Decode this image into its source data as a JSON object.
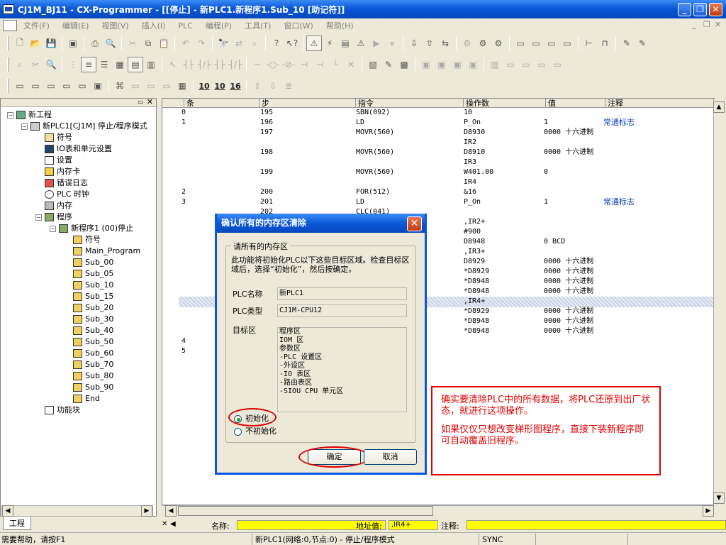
{
  "window": {
    "title": "CJ1M_BJ11 - CX-Programmer - [[停止] - 新PLC1.新程序1.Sub_10 [助记符]]"
  },
  "menu": [
    "文件(F)",
    "编辑(E)",
    "视图(V)",
    "插入(I)",
    "PLC",
    "编程(P)",
    "工具(T)",
    "窗口(W)",
    "帮助(H)"
  ],
  "toolbar": {
    "num1": "10",
    "num2": "10",
    "num3": "16"
  },
  "tree": {
    "root": "新工程",
    "plc": "新PLC1[CJ1M] 停止/程序模式",
    "items": [
      "符号",
      "IO表和单元设置",
      "设置",
      "内存卡",
      "错误日志",
      "PLC 时钟",
      "内存"
    ],
    "programs": "程序",
    "program1": "新程序1 (00)停止",
    "subitems": [
      "符号",
      "Main_Program",
      "Sub_00",
      "Sub_05",
      "Sub_10",
      "Sub_15",
      "Sub_20",
      "Sub_30",
      "Sub_40",
      "Sub_50",
      "Sub_60",
      "Sub_70",
      "Sub_80",
      "Sub_90",
      "End"
    ],
    "function_blocks": "功能块",
    "tab": "工程"
  },
  "grid": {
    "headers": [
      "条",
      "步",
      "指令",
      "操作数",
      "值",
      "注释"
    ],
    "rows": [
      {
        "rung": "0",
        "step": "195",
        "instr": "SBN(092)",
        "op": "10",
        "val": "",
        "comment": ""
      },
      {
        "rung": "1",
        "step": "196",
        "instr": "LD",
        "op": "P_On",
        "val": "1",
        "comment": "常通标志"
      },
      {
        "rung": "",
        "step": "197",
        "instr": "MOVR(560)",
        "op": "D8930",
        "val": "0000 十六进制",
        "comment": ""
      },
      {
        "rung": "",
        "step": "",
        "instr": "",
        "op": "IR2",
        "val": "",
        "comment": ""
      },
      {
        "rung": "",
        "step": "198",
        "instr": "MOVR(560)",
        "op": "D8910",
        "val": "0000 十六进制",
        "comment": ""
      },
      {
        "rung": "",
        "step": "",
        "instr": "",
        "op": "IR3",
        "val": "",
        "comment": ""
      },
      {
        "rung": "",
        "step": "199",
        "instr": "MOVR(560)",
        "op": "W401.00",
        "val": "0",
        "comment": ""
      },
      {
        "rung": "",
        "step": "",
        "instr": "",
        "op": "IR4",
        "val": "",
        "comment": ""
      },
      {
        "rung": "2",
        "step": "200",
        "instr": "FOR(512)",
        "op": "&16",
        "val": "",
        "comment": ""
      },
      {
        "rung": "3",
        "step": "201",
        "instr": "LD",
        "op": "P_On",
        "val": "1",
        "comment": "常通标志"
      },
      {
        "rung": "",
        "step": "202",
        "instr": "CLC(041)",
        "op": "",
        "val": "",
        "comment": ""
      },
      {
        "rung": "",
        "step": "",
        "instr": "",
        "op": ",IR2+",
        "val": "",
        "comment": ""
      },
      {
        "rung": "",
        "step": "",
        "instr": "",
        "op": "#900",
        "val": "",
        "comment": ""
      },
      {
        "rung": "",
        "step": "",
        "instr": "",
        "op": "D8948",
        "val": "0 BCD",
        "comment": ""
      },
      {
        "rung": "",
        "step": "",
        "instr": "",
        "op": ",IR3+",
        "val": "",
        "comment": ""
      },
      {
        "rung": "",
        "step": "",
        "instr": "",
        "op": "D8929",
        "val": "0000 十六进制",
        "comment": ""
      },
      {
        "rung": "",
        "step": "",
        "instr": "",
        "op": "*D8929",
        "val": "0000 十六进制",
        "comment": ""
      },
      {
        "rung": "",
        "step": "",
        "instr": "",
        "op": "*D8948",
        "val": "0000 十六进制",
        "comment": ""
      },
      {
        "rung": "",
        "step": "",
        "instr": "",
        "op": "*D8948",
        "val": "0000 十六进制",
        "comment": ""
      },
      {
        "rung": "",
        "step": "",
        "instr": "",
        "op": ",IR4+",
        "val": "",
        "comment": ""
      },
      {
        "rung": "",
        "step": "",
        "instr": "",
        "op": "*D8929",
        "val": "0000 十六进制",
        "comment": ""
      },
      {
        "rung": "",
        "step": "",
        "instr": "",
        "op": "*D8948",
        "val": "0000 十六进制",
        "comment": ""
      },
      {
        "rung": "",
        "step": "",
        "instr": "",
        "op": "*D8948",
        "val": "0000 十六进制",
        "comment": ""
      },
      {
        "rung": "4",
        "step": "",
        "instr": "",
        "op": "",
        "val": "",
        "comment": ""
      },
      {
        "rung": "5",
        "step": "",
        "instr": "",
        "op": "",
        "val": "",
        "comment": ""
      }
    ]
  },
  "bottom": {
    "name_label": "名称:",
    "addr_label": "地址值:",
    "addr_value": ",IR4+",
    "comment_label": "注释:"
  },
  "status": {
    "help": "需要帮助，请按F1",
    "plc": "新PLC1(网络:0,节点:0) - 停止/程序模式",
    "sync": "SYNC"
  },
  "dialog": {
    "title": "确认所有的内存区清除",
    "group": "请所有的内存区",
    "desc": "此功能将初始化PLC以下这些目标区域。检查目标区域后，选择“初始化”，然后按确定。",
    "plc_name_label": "PLC名称",
    "plc_name": "新PLC1",
    "plc_type_label": "PLC类型",
    "plc_type": "CJ1M-CPU12",
    "target_label": "目标区",
    "targets": [
      "程序区",
      "IOM 区",
      "参数区",
      "-PLC 设置区",
      "-外设区",
      "-IO 表区",
      "-路由表区",
      "-SIOU CPU 单元区"
    ],
    "radio_init": "初始化",
    "radio_noinit": "不初始化",
    "ok": "确定",
    "cancel": "取消"
  },
  "note": {
    "line1": "确实要清除PLC中的所有数据，将PLC还原到出厂状态，就进行这项操作。",
    "line2": "如果仅仅只想改变梯形图程序，直接下装新程序即可自动覆盖旧程序。"
  }
}
